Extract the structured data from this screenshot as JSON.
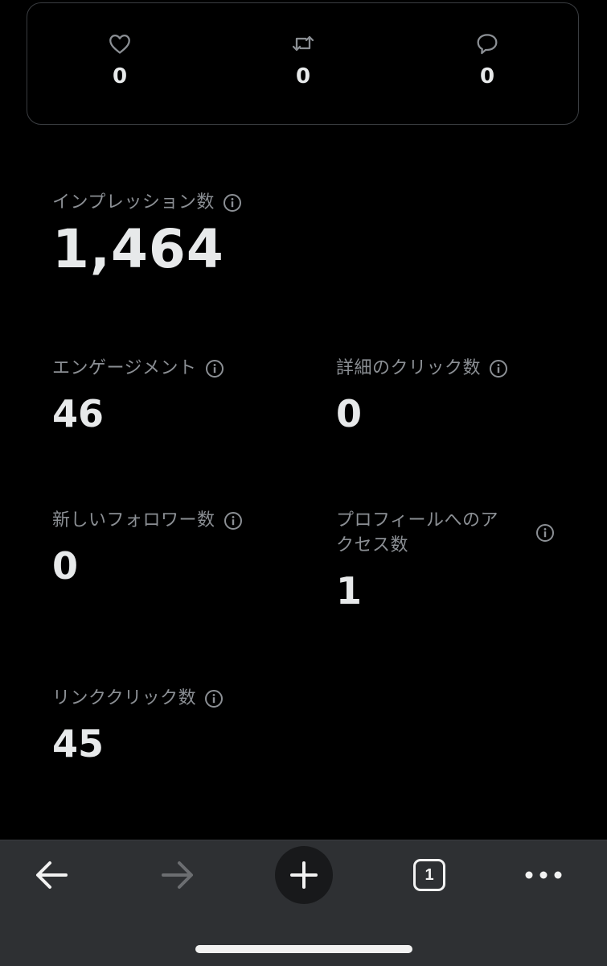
{
  "engagement": {
    "likes": {
      "icon": "heart-icon",
      "count": "0"
    },
    "reposts": {
      "icon": "repost-icon",
      "count": "0"
    },
    "replies": {
      "icon": "reply-icon",
      "count": "0"
    }
  },
  "metrics": {
    "impressions": {
      "label": "インプレッション数",
      "value": "1,464"
    },
    "engagements": {
      "label": "エンゲージメント",
      "value": "46"
    },
    "detail_clicks": {
      "label": "詳細のクリック数",
      "value": "0"
    },
    "new_followers": {
      "label": "新しいフォロワー数",
      "value": "0"
    },
    "profile_visits": {
      "label_line1": "プロフィールへのア",
      "label_line2": "クセス数",
      "value": "1"
    },
    "link_clicks": {
      "label": "リンククリック数",
      "value": "45"
    }
  },
  "browser_bar": {
    "tab_count": "1",
    "icons": [
      "back-arrow-icon",
      "forward-arrow-icon",
      "plus-icon",
      "tabs-icon",
      "more-icon"
    ]
  },
  "colors": {
    "background": "#000000",
    "text_primary": "#e7e9ea",
    "text_secondary": "#8b8f94",
    "card_border": "#3a3d41",
    "toolbar_bg": "#2e3033",
    "forward_disabled": "#6c6e71"
  }
}
